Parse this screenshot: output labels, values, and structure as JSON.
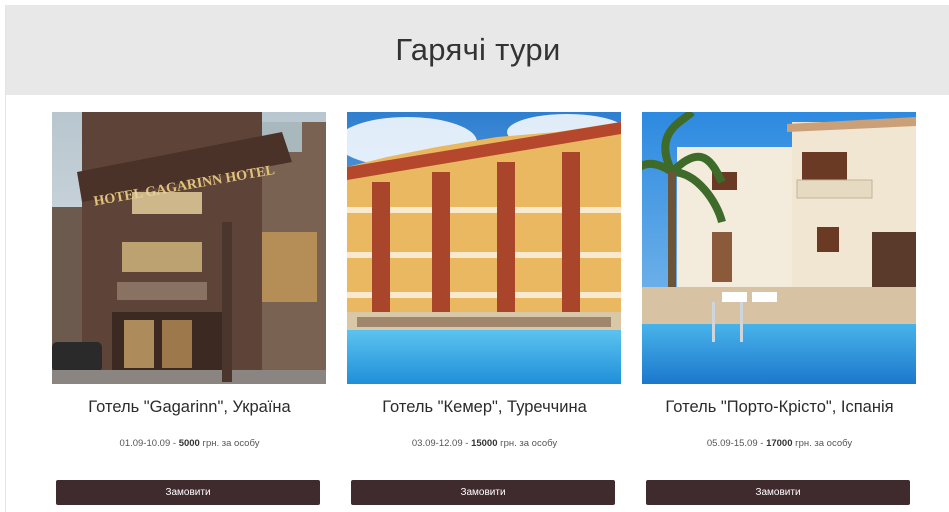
{
  "header": {
    "title": "Гарячі тури"
  },
  "tours": [
    {
      "title": "Готель \"Gagarinn\", Україна",
      "dates": "01.09-10.09",
      "separator": " - ",
      "price": "5000",
      "price_suffix": " грн. за особу",
      "button": "Замовити",
      "photo_sign": "HOTEL GAGARINN HOTEL"
    },
    {
      "title": "Готель \"Кемер\",  Туреччина",
      "dates": "03.09-12.09",
      "separator": " - ",
      "price": "15000",
      "price_suffix": " грн. за особу",
      "button": "Замовити"
    },
    {
      "title": "Готель \"Порто-Крісто\", Іспанія",
      "dates": "05.09-15.09",
      "separator": " - ",
      "price": "17000",
      "price_suffix": " грн. за особу",
      "button": "Замовити"
    }
  ]
}
